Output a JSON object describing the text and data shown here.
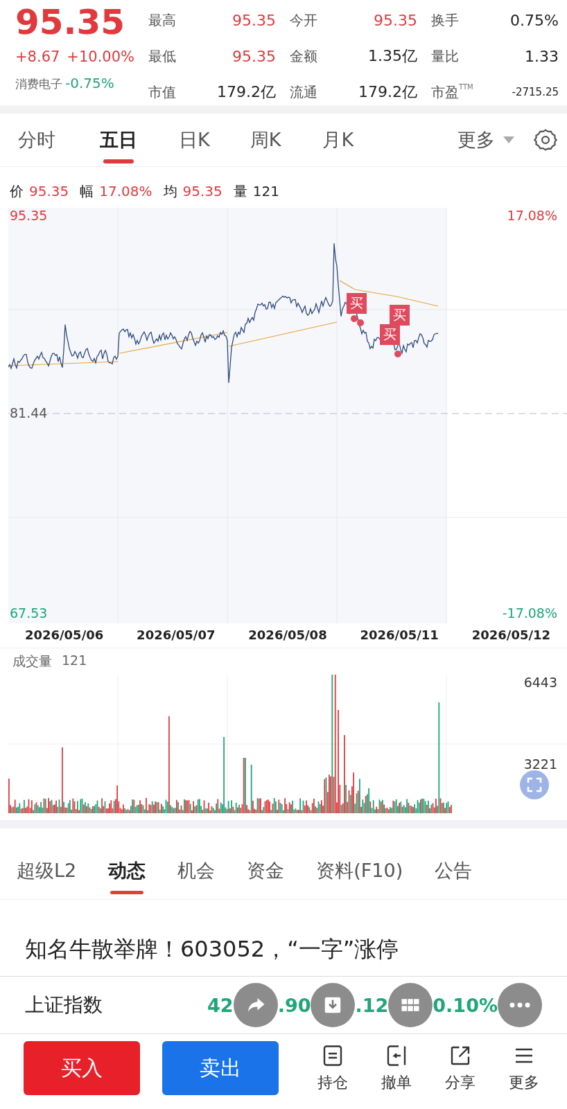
{
  "quote": {
    "price": "95.35",
    "change": "+8.67",
    "change_pct": "+10.00%",
    "sector": {
      "name": "消费电子",
      "change": "-0.75%"
    }
  },
  "stats": [
    {
      "label": "最高",
      "value": "95.35",
      "color": "#e03a3e"
    },
    {
      "label": "今开",
      "value": "95.35",
      "color": "#e03a3e"
    },
    {
      "label": "换手",
      "value": "0.75%",
      "color": "#222222"
    },
    {
      "label": "最低",
      "value": "95.35",
      "color": "#e03a3e"
    },
    {
      "label": "金额",
      "value": "1.35亿",
      "color": "#222222"
    },
    {
      "label": "量比",
      "value": "1.33",
      "color": "#222222"
    },
    {
      "label": "市值",
      "value": "179.2亿",
      "color": "#222222"
    },
    {
      "label": "流通",
      "value": "179.2亿",
      "color": "#222222"
    },
    {
      "label": "市盈",
      "superscript": "TTM",
      "value": "-2715.25",
      "color": "#222222"
    }
  ],
  "period_tabs": [
    {
      "label": "分时",
      "selected": false
    },
    {
      "label": "五日",
      "selected": true
    },
    {
      "label": "日K",
      "selected": false
    },
    {
      "label": "周K",
      "selected": false
    },
    {
      "label": "月K",
      "selected": false
    }
  ],
  "more_tab": {
    "label": "更多"
  },
  "info_line": [
    {
      "label": "价",
      "value": "95.35",
      "color": "#e03a3e"
    },
    {
      "label": "幅",
      "value": "17.08%",
      "color": "#e03a3e"
    },
    {
      "label": "均",
      "value": "95.35",
      "color": "#e03a3e"
    },
    {
      "label": "量",
      "value": "121",
      "color": "#222222"
    }
  ],
  "price_chart": {
    "top_price": "95.35",
    "mid_price": "81.44",
    "bottom_price": "67.53",
    "top_pct": "17.08%",
    "bottom_pct": "-17.08%",
    "markers": [
      {
        "label": "买"
      },
      {
        "label": "买"
      },
      {
        "label": "买"
      }
    ],
    "dates": [
      "2026/05/06",
      "2026/05/07",
      "2026/05/08",
      "2026/05/11",
      "2026/05/12"
    ]
  },
  "volume_chart": {
    "title": "成交量",
    "value": "121",
    "max": "6443",
    "mid": "3221"
  },
  "section_tabs": [
    {
      "label": "超级L2",
      "selected": false
    },
    {
      "label": "动态",
      "selected": true
    },
    {
      "label": "机会",
      "selected": false
    },
    {
      "label": "资金",
      "selected": false
    },
    {
      "label": "资料(F10)",
      "selected": false
    },
    {
      "label": "公告",
      "selected": false
    }
  ],
  "headline": "知名牛散举牌！603052，“一字”涨停",
  "index_row": {
    "name": "上证指数",
    "fragments": [
      "42",
      ".90",
      ".12",
      "0.10%"
    ]
  },
  "trade_buttons": [
    {
      "label": "买入",
      "kind": "buy"
    },
    {
      "label": "卖出",
      "kind": "sell"
    }
  ],
  "tools": [
    {
      "label": "持仓",
      "kind": "doc"
    },
    {
      "label": "撤单",
      "kind": "undo"
    },
    {
      "label": "分享",
      "kind": "share"
    },
    {
      "label": "更多",
      "kind": "list"
    }
  ]
}
